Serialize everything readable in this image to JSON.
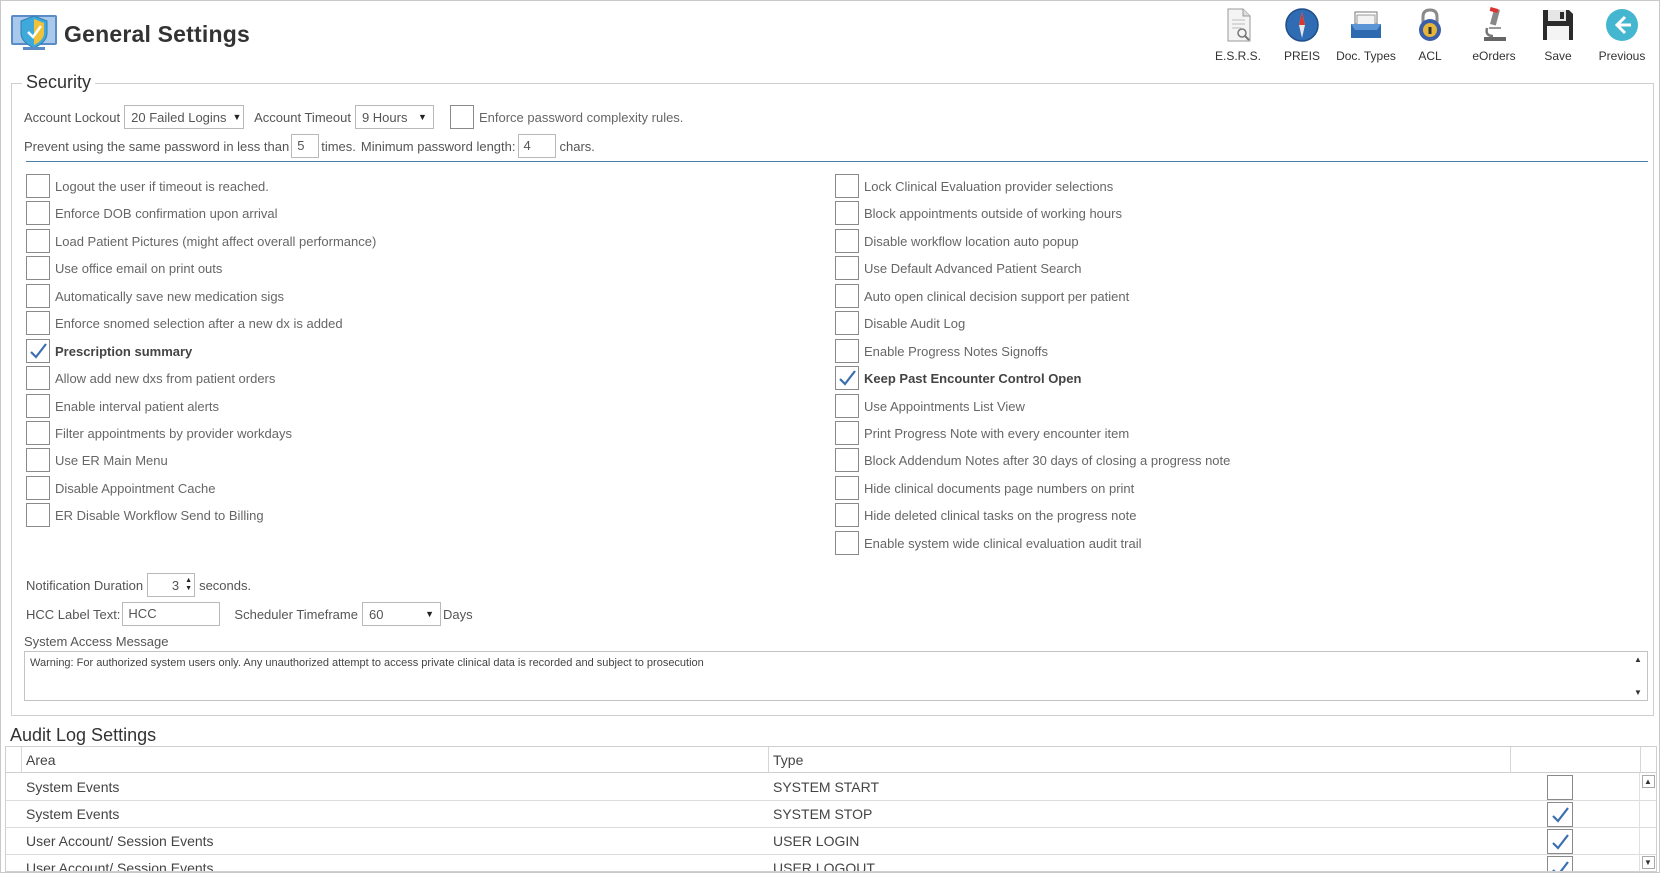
{
  "header": {
    "title": "General Settings"
  },
  "toolbar": [
    {
      "label": "E.S.R.S.",
      "icon": "document-search-icon"
    },
    {
      "label": "PREIS",
      "icon": "compass-icon"
    },
    {
      "label": "Doc. Types",
      "icon": "inbox-tray-icon"
    },
    {
      "label": "ACL",
      "icon": "padlock-icon"
    },
    {
      "label": "eOrders",
      "icon": "microscope-icon"
    },
    {
      "label": "Save",
      "icon": "floppy-disk-icon"
    },
    {
      "label": "Previous",
      "icon": "back-arrow-icon"
    }
  ],
  "security": {
    "title": "Security",
    "account_lockout_label": "Account Lockout",
    "account_lockout_value": "20 Failed Logins",
    "account_timeout_label": "Account Timeout",
    "account_timeout_value": "9 Hours",
    "enforce_complexity_label": "Enforce password complexity rules.",
    "prevent_reuse_label": "Prevent using the same password in less than",
    "prevent_reuse_value": "5",
    "times_label": "times.",
    "min_length_label": "Minimum password length:",
    "min_length_value": "4",
    "chars_label": "chars.",
    "left_options": [
      {
        "label": "Logout the user if timeout is reached.",
        "checked": false
      },
      {
        "label": "Enforce DOB confirmation upon arrival",
        "checked": false
      },
      {
        "label": "Load Patient Pictures (might affect overall performance)",
        "checked": false
      },
      {
        "label": "Use office email on print outs",
        "checked": false
      },
      {
        "label": "Automatically save new medication sigs",
        "checked": false
      },
      {
        "label": "Enforce snomed selection after a new dx is added",
        "checked": false
      },
      {
        "label": "Prescription summary",
        "checked": true
      },
      {
        "label": "Allow add new dxs from patient orders",
        "checked": false
      },
      {
        "label": "Enable interval patient alerts",
        "checked": false
      },
      {
        "label": "Filter appointments by provider workdays",
        "checked": false
      },
      {
        "label": "Use ER Main Menu",
        "checked": false
      },
      {
        "label": "Disable Appointment Cache",
        "checked": false
      },
      {
        "label": "ER Disable Workflow Send to Billing",
        "checked": false
      }
    ],
    "right_options": [
      {
        "label": "Lock Clinical Evaluation provider selections",
        "checked": false
      },
      {
        "label": "Block appointments outside of working hours",
        "checked": false
      },
      {
        "label": "Disable workflow location auto popup",
        "checked": false
      },
      {
        "label": "Use Default Advanced Patient Search",
        "checked": false
      },
      {
        "label": "Auto open clinical decision support per patient",
        "checked": false
      },
      {
        "label": "Disable Audit Log",
        "checked": false
      },
      {
        "label": "Enable Progress Notes Signoffs",
        "checked": false
      },
      {
        "label": "Keep Past Encounter Control Open",
        "checked": true
      },
      {
        "label": "Use Appointments List View",
        "checked": false
      },
      {
        "label": "Print Progress Note with every encounter item",
        "checked": false
      },
      {
        "label": "Block Addendum Notes after 30 days of closing a progress note",
        "checked": false
      },
      {
        "label": "Hide clinical documents page numbers on print",
        "checked": false
      },
      {
        "label": "Hide deleted clinical tasks on the progress note",
        "checked": false
      },
      {
        "label": "Enable system wide clinical evaluation audit trail",
        "checked": false
      }
    ],
    "notification_label": "Notification Duration",
    "notification_value": "3",
    "seconds_label": "seconds.",
    "hcc_label": "HCC Label Text:",
    "hcc_value": "HCC",
    "scheduler_label": "Scheduler Timeframe",
    "scheduler_value": "60",
    "days_label": "Days",
    "access_message_label": "System Access Message",
    "access_message_value": "Warning: For authorized system users only. Any unauthorized attempt to access private clinical data is recorded and subject to prosecution"
  },
  "audit": {
    "title": "Audit Log Settings",
    "columns": [
      "Area",
      "Type",
      ""
    ],
    "rows": [
      {
        "area": "System Events",
        "type": "SYSTEM START",
        "enabled": false
      },
      {
        "area": "System Events",
        "type": "SYSTEM STOP",
        "enabled": true
      },
      {
        "area": "User Account/ Session Events",
        "type": "USER LOGIN",
        "enabled": true
      },
      {
        "area": "User Account/ Session Events",
        "type": "USER LOGOUT",
        "enabled": true
      }
    ]
  },
  "colors": {
    "accent": "#4a7fa9",
    "check": "#3b6fb0"
  }
}
